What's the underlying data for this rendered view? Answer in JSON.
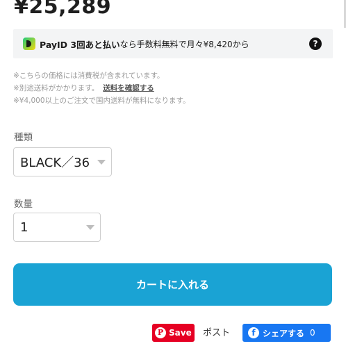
{
  "price": "¥25,289",
  "payid": {
    "brand": "PayID 3回あと払い",
    "message": "なら手数料無料で月々¥8,420から",
    "help_icon": "?"
  },
  "notes": {
    "tax": "※こちらの価格には消費税が含まれています。",
    "shipping": "※別途送料がかかります。",
    "shipping_link": "送料を確認する",
    "free_shipping": "※¥4,000以上のご注文で国内送料が無料になります。"
  },
  "variant": {
    "label": "種類",
    "selected": "BLACK／36"
  },
  "quantity": {
    "label": "数量",
    "selected": "1"
  },
  "cart_button": "カートに入れる",
  "share": {
    "pinterest_icon": "P",
    "pinterest_label": "Save",
    "post_label": "ポスト",
    "facebook_icon": "f",
    "facebook_label": "シェアする",
    "facebook_count": "0"
  },
  "colors": {
    "cart_button": "#1aa3d4",
    "pinterest": "#e60023",
    "facebook": "#1877f2"
  },
  "icons": [
    "payid-logo-icon",
    "help-icon",
    "chevron-down-icon",
    "pinterest-icon",
    "facebook-icon"
  ]
}
